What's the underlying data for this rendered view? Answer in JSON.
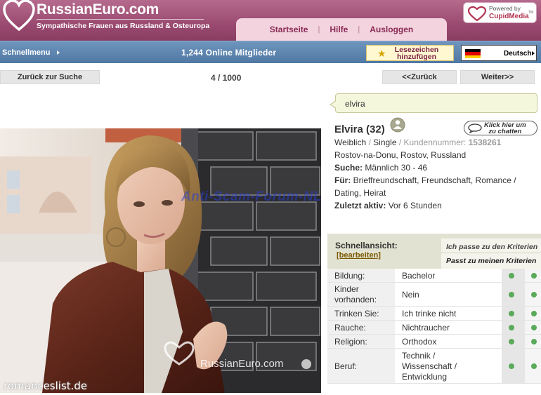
{
  "header": {
    "logo_title": "RussianEuro.com",
    "logo_subtitle": "Sympathische Frauen aus Russland & Osteuropa",
    "nav": [
      "Startseite",
      "Hilfe",
      "Ausloggen"
    ],
    "nav_separator": "|",
    "powered_by_line1": "Powered by",
    "powered_by_brand": "CupidMedia",
    "powered_by_tm": "TM"
  },
  "bluebar": {
    "quick_menu": "Schnellmenu",
    "online_members": "1,244 Online Mitglieder",
    "bookmark_line1": "Lesezeichen",
    "bookmark_line2": "hinzufügen",
    "language": "Deutsch"
  },
  "navrow": {
    "back_to_search": "Zurück zur Suche",
    "pager": "4 / 1000",
    "prev": "<<Zurück",
    "next": "Weiter>>"
  },
  "photo": {
    "brand_watermark": "RussianEuro.com",
    "footer_watermark": "romanceslist.de"
  },
  "profile": {
    "username": "elvira",
    "name_age": "Elvira (32)",
    "chat_line1": "Klick hier um",
    "chat_line2": "zu chatten",
    "gender": "Weiblich",
    "status": "Single",
    "customer_label": "Kundennummer:",
    "customer_number": "1538261",
    "location": "Rostov-na-Donu, Rostov, Russland",
    "search_label": "Suche:",
    "search_value": "Männlich 30 - 46",
    "for_label": "Für:",
    "for_value_1": "Brieffreundschaft, Freundschaft, Romance /",
    "for_value_2": "Dating, Heirat",
    "last_active_label": "Zuletzt aktiv:",
    "last_active_value": "Vor 6 Stunden",
    "overlay_watermark": "Anti-Scam-Forum-NL"
  },
  "quickview": {
    "title": "Schnellansicht:",
    "edit": "[bearbeiten]",
    "criteria_1": "Ich passe zu den Kriterien",
    "criteria_2": "Passt zu meinen Kriterien",
    "rows": [
      {
        "label": "Bildung:",
        "value": "Bachelor"
      },
      {
        "label": "Kinder vorhanden:",
        "value": "Nein"
      },
      {
        "label": "Trinken Sie:",
        "value": "Ich trinke nicht"
      },
      {
        "label": "Rauche:",
        "value": "Nichtraucher"
      },
      {
        "label": "Religion:",
        "value": "Orthodox"
      },
      {
        "label": "Beruf:",
        "value": "Technik / Wissenschaft / Entwicklung"
      }
    ],
    "match_color": "#5aaa5a"
  }
}
